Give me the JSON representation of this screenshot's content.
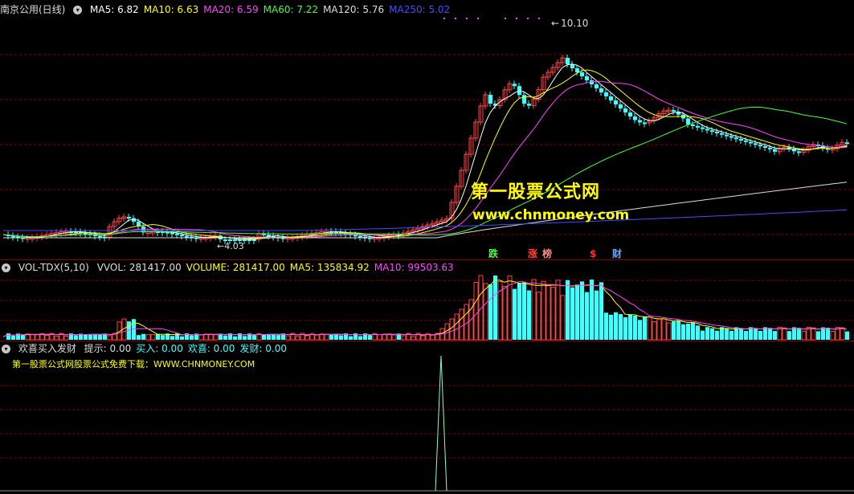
{
  "main_panel": {
    "title": "南京公用(日线)",
    "ma_items": [
      {
        "label": "MA5: 6.82",
        "color": "#ffffff"
      },
      {
        "label": "MA10: 6.63",
        "color": "#ffff00"
      },
      {
        "label": "MA20: 6.59",
        "color": "#ff44ff"
      },
      {
        "label": "MA60: 7.22",
        "color": "#44ff44"
      },
      {
        "label": "MA120: 5.76",
        "color": "#dddddd"
      },
      {
        "label": "MA250: 5.02",
        "color": "#4a4aff"
      }
    ],
    "peak_label": "10.10",
    "low_label": "4.03",
    "watermark_cn": "第一股票公式网",
    "watermark_url": "www.chnmoney.com",
    "tags": [
      {
        "text": "跌",
        "color": "#44ff44"
      },
      {
        "text": "涨",
        "color": "#ff4444"
      },
      {
        "text": "榜",
        "color": "#ff8888"
      },
      {
        "text": "$",
        "color": "#ff3333"
      },
      {
        "text": "财",
        "color": "#66aaff"
      }
    ]
  },
  "volume_panel": {
    "indicator": "VOL-TDX(5,10)",
    "items": [
      {
        "label": "VVOL: 281417.00",
        "color": "#dddddd"
      },
      {
        "label": "VOLUME: 281417.00",
        "color": "#ffff00"
      },
      {
        "label": "MA5: 135834.92",
        "color": "#ffff00"
      },
      {
        "label": "MA10: 99503.63",
        "color": "#ff44ff"
      }
    ]
  },
  "signal_panel": {
    "indicator": "欢喜买入发财",
    "items": [
      {
        "label": "提示: 0.00",
        "color": "#dddddd"
      },
      {
        "label": "买入: 0.00",
        "color": "#44ffff"
      },
      {
        "label": "欢喜: 0.00",
        "color": "#44ffff"
      },
      {
        "label": "发财: 0.00",
        "color": "#44ffff"
      }
    ],
    "download_text": "第一股票公式网股票公式免费下载：WWW.CHNMONEY.COM"
  },
  "colors": {
    "up": "#ff4444",
    "down": "#44ffff",
    "grid": "#8b0000",
    "separator": "#8b0000"
  }
}
